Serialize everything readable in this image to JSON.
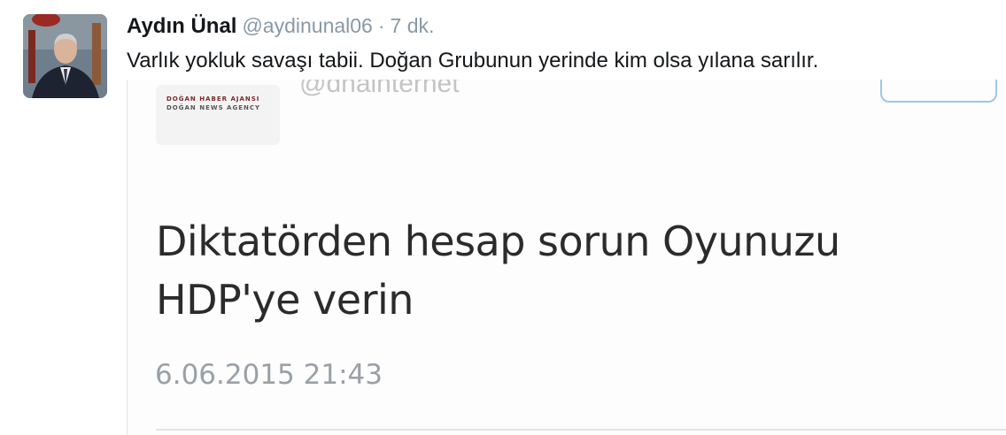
{
  "tweet": {
    "name": "Aydın Ünal",
    "handle": "@aydinunal06",
    "separator": "·",
    "time": "7 dk.",
    "text": "Varlık yokluk savaşı tabii. Doğan Grubunun yerinde kim olsa yılana sarılır."
  },
  "embed": {
    "logo_line1": "DOĞAN HABER AJANSI",
    "logo_line2": "DOĞAN NEWS AGENCY",
    "handle": "@dhainternet",
    "body_line1": "Diktatörden hesap sorun Oyunuzu",
    "body_line2": "HDP'ye verin",
    "date": "6.06.2015 21:43"
  },
  "colors": {
    "name": "#14171a",
    "meta": "#8899a6",
    "follow_border": "#9fc7e4"
  },
  "icons": {
    "avatar": "profile-photo"
  }
}
